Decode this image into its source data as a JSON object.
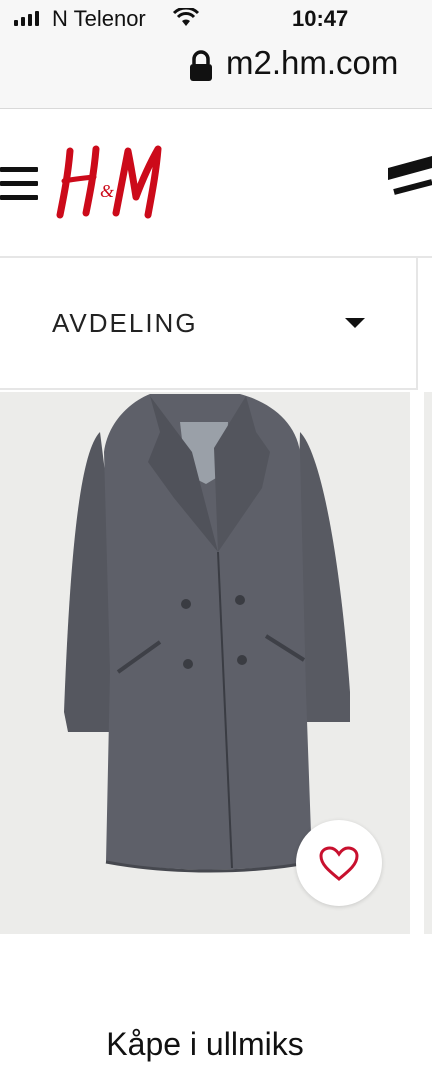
{
  "status_bar": {
    "carrier": "N Telenor",
    "time": "10:47",
    "url": "m2.hm.com"
  },
  "header": {
    "logo_text": "H&M",
    "brand_color": "#cc0a1a"
  },
  "department": {
    "label": "AVDELING"
  },
  "product": {
    "name": "Kåpe i ullmiks",
    "wishlist_icon": "heart-outline-icon",
    "heart_color": "#c8102e"
  }
}
